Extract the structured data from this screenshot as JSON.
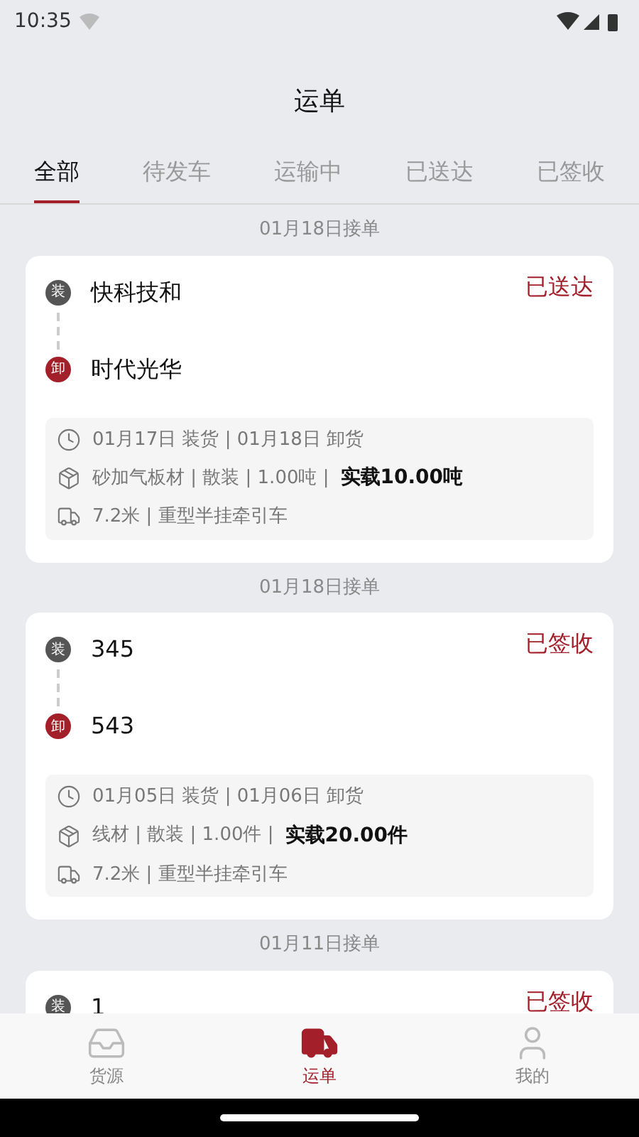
{
  "status_bar": {
    "time": "10:35"
  },
  "title": "运单",
  "tabs": [
    {
      "label": "全部",
      "selected": true
    },
    {
      "label": "待发车",
      "selected": false
    },
    {
      "label": "运输中",
      "selected": false
    },
    {
      "label": "已送达",
      "selected": false
    },
    {
      "label": "已签收",
      "selected": false
    }
  ],
  "orders": [
    {
      "date_label": "01月18日接单",
      "load_badge": "装",
      "load_name": "快科技和",
      "unload_badge": "卸",
      "unload_name": "时代光华",
      "status": "已送达",
      "times": "01月17日 装货 | 01月18日 卸货",
      "cargo": "砂加气板材 | 散装 | 1.00吨 |",
      "actual_load": "实载10.00吨",
      "vehicle": "7.2米 | 重型半挂牵引车"
    },
    {
      "date_label": "01月18日接单",
      "load_badge": "装",
      "load_name": "345",
      "unload_badge": "卸",
      "unload_name": "543",
      "status": "已签收",
      "times": "01月05日 装货 | 01月06日 卸货",
      "cargo": "线材 | 散装 | 1.00件 |",
      "actual_load": "实载20.00件",
      "vehicle": "7.2米 | 重型半挂牵引车"
    },
    {
      "date_label": "01月11日接单",
      "load_badge": "装",
      "load_name": "1",
      "status": "已签收"
    }
  ],
  "bottom_nav": [
    {
      "kind": "cargo",
      "label": "货源",
      "selected": false
    },
    {
      "kind": "waybill",
      "label": "运单",
      "selected": true
    },
    {
      "kind": "profile",
      "label": "我的",
      "selected": false
    }
  ]
}
